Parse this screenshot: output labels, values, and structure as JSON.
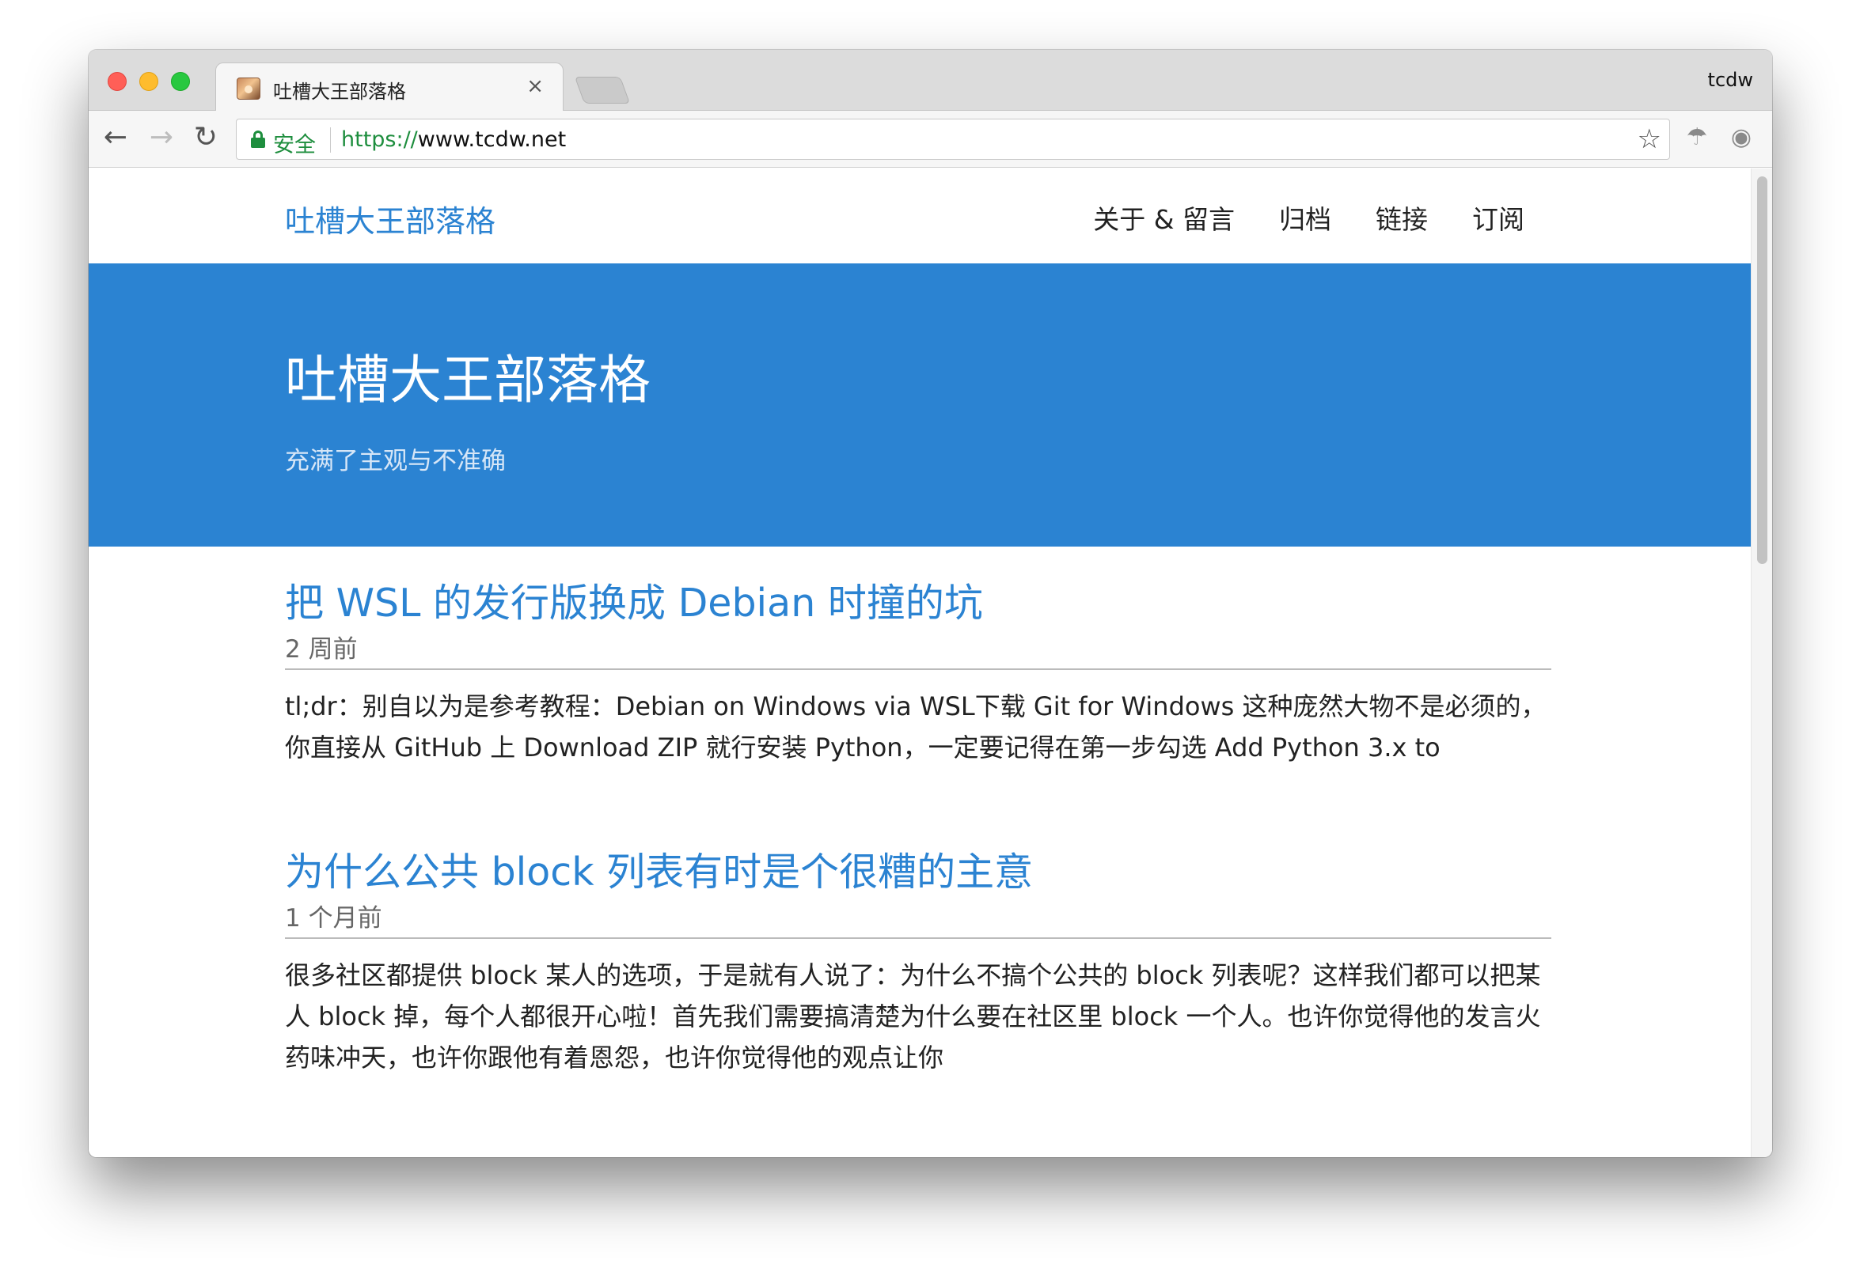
{
  "browser": {
    "tab_title": "吐槽大王部落格",
    "tab_close": "×",
    "profile_name": "tcdw",
    "secure_label": "安全",
    "url_scheme": "https://",
    "url_rest": "www.tcdw.net"
  },
  "site": {
    "brand": "吐槽大王部落格",
    "nav": [
      "关于 & 留言",
      "归档",
      "链接",
      "订阅"
    ],
    "hero_title": "吐槽大王部落格",
    "hero_subtitle": "充满了主观与不准确"
  },
  "posts": [
    {
      "title": "把 WSL 的发行版换成 Debian 时撞的坑",
      "meta": "2 周前",
      "excerpt": "tl;dr：别自以为是参考教程：Debian on Windows via WSL下载 Git for Windows 这种庞然大物不是必须的，你直接从 GitHub 上 Download ZIP 就行安装 Python，一定要记得在第一步勾选 Add Python 3.x to"
    },
    {
      "title": "为什么公共 block 列表有时是个很糟的主意",
      "meta": "1 个月前",
      "excerpt": "很多社区都提供 block 某人的选项，于是就有人说了：为什么不搞个公共的 block 列表呢？这样我们都可以把某人 block 掉，每个人都很开心啦！首先我们需要搞清楚为什么要在社区里 block 一个人。也许你觉得他的发言火药味冲天，也许你跟他有着恩怨，也许你觉得他的观点让你"
    }
  ],
  "colors": {
    "accent": "#2b83d2",
    "secure_green": "#1e8e3e"
  },
  "icons": {
    "back": "arrow-left",
    "forward": "arrow-right",
    "reload": "reload",
    "bookmark": "star",
    "extensions": [
      "parachute",
      "camera",
      "bank",
      "more-vertical"
    ]
  }
}
